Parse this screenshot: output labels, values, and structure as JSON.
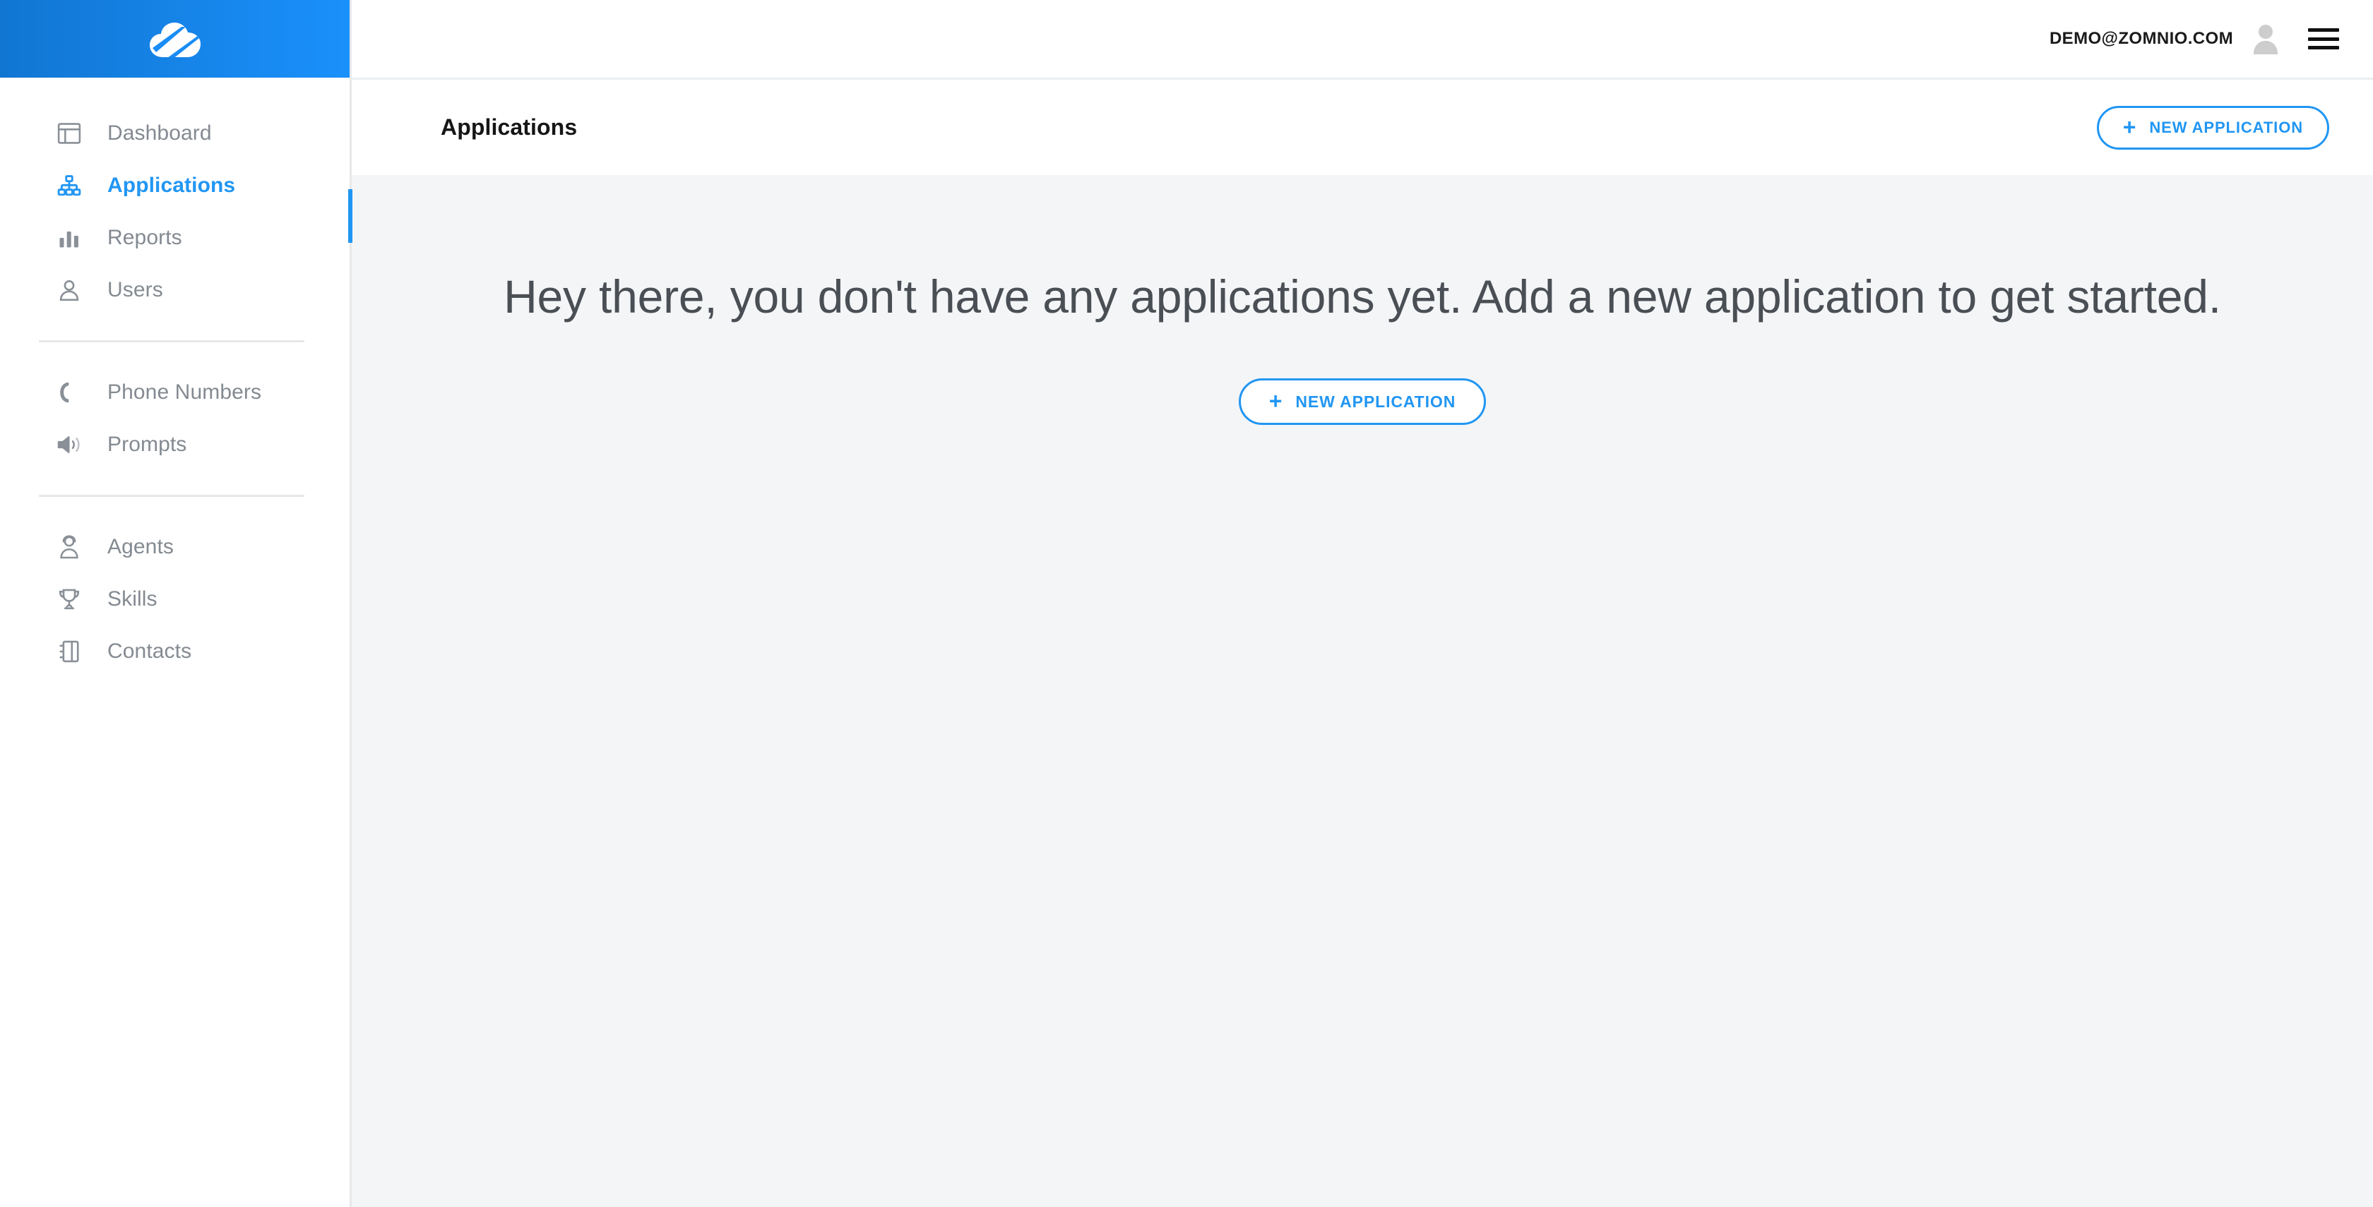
{
  "brand": {
    "logo_icon": "cloud-logo-icon",
    "accent_color": "#2196f3",
    "header_gradient_from": "#1176d2",
    "header_gradient_to": "#1a90fb"
  },
  "topbar": {
    "user_email": "DEMO@ZOMNIO.COM",
    "avatar_icon": "user-avatar-icon",
    "menu_icon": "hamburger-menu-icon"
  },
  "sidebar": {
    "groups": [
      {
        "items": [
          {
            "label": "Dashboard",
            "icon": "dashboard-window-icon",
            "active": false
          },
          {
            "label": "Applications",
            "icon": "sitemap-icon",
            "active": true
          },
          {
            "label": "Reports",
            "icon": "bar-chart-icon",
            "active": false
          },
          {
            "label": "Users",
            "icon": "user-icon",
            "active": false
          }
        ]
      },
      {
        "items": [
          {
            "label": "Phone Numbers",
            "icon": "phone-icon",
            "active": false
          },
          {
            "label": "Prompts",
            "icon": "speaker-volume-icon",
            "active": false
          }
        ]
      },
      {
        "items": [
          {
            "label": "Agents",
            "icon": "headset-agent-icon",
            "active": false
          },
          {
            "label": "Skills",
            "icon": "trophy-icon",
            "active": false
          },
          {
            "label": "Contacts",
            "icon": "address-book-icon",
            "active": false
          }
        ]
      }
    ]
  },
  "page": {
    "title": "Applications",
    "new_application_label": "NEW APPLICATION",
    "plus_glyph": "+"
  },
  "empty_state": {
    "message": "Hey there, you don't have any applications yet. Add a new application to get started.",
    "new_application_label": "NEW APPLICATION",
    "plus_glyph": "+"
  }
}
